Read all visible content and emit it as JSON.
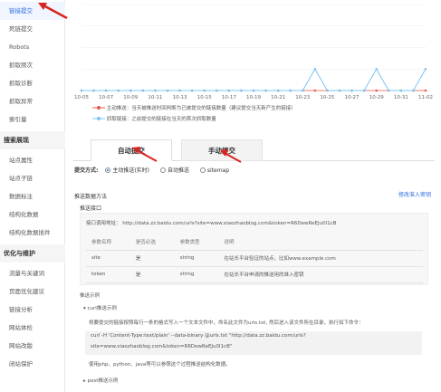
{
  "sidebar": {
    "items": [
      {
        "label": "链接提交",
        "active": true
      },
      {
        "label": "死链提交"
      },
      {
        "label": "Robots"
      },
      {
        "label": "抓取频次"
      },
      {
        "label": "抓取诊断"
      },
      {
        "label": "抓取异常"
      },
      {
        "label": "索引量"
      }
    ],
    "group1": "搜索展现",
    "group1_items": [
      {
        "label": "站点属性"
      },
      {
        "label": "站点子链"
      },
      {
        "label": "数据标注"
      },
      {
        "label": "结构化数据"
      },
      {
        "label": "结构化数据插件"
      }
    ],
    "group2": "优化与维护",
    "group2_items": [
      {
        "label": "流量与关键词"
      },
      {
        "label": "页面优化建议"
      },
      {
        "label": "链接分析"
      },
      {
        "label": "网站体检"
      },
      {
        "label": "网站改版"
      },
      {
        "label": "闭站保护"
      }
    ]
  },
  "chart_data": {
    "type": "line",
    "categories": [
      "10-05",
      "10-07",
      "10-09",
      "10-11",
      "10-13",
      "10-15",
      "10-17",
      "10-19",
      "10-21",
      "10-23",
      "10-25",
      "10-27",
      "10-29",
      "10-31",
      "11-02"
    ],
    "series": [
      {
        "name": "主动推送：当天被推送时间判断为已被提交的链接数量（建议提交当天新产生的链接）",
        "color": "#e8574e",
        "values": [
          0,
          0,
          0,
          0,
          0,
          0,
          0,
          0,
          0,
          0,
          0,
          0,
          0,
          0,
          0,
          0,
          0,
          0,
          0,
          0,
          0,
          0,
          0,
          0,
          0,
          0,
          0,
          0,
          0
        ]
      },
      {
        "name": "抓取链接：之前提交的链接在当天的首次抓取数量",
        "color": "#7ec4f2",
        "values": [
          0,
          0,
          0,
          0,
          0,
          0,
          0,
          0,
          0,
          0,
          0,
          0,
          0,
          0,
          0,
          0,
          0,
          0,
          0,
          1,
          0,
          0,
          0,
          0,
          1,
          0,
          0,
          0,
          1
        ]
      }
    ],
    "ylim": [
      0,
      4
    ],
    "grid": true
  },
  "tabs": [
    {
      "label": "自动提交",
      "active": true
    },
    {
      "label": "手动提交",
      "active": false
    }
  ],
  "submit_mode": {
    "label": "提交方式:",
    "options": [
      {
        "label": "主动推送(实时)",
        "selected": true
      },
      {
        "label": "自动推送",
        "selected": false
      },
      {
        "label": "sitemap",
        "selected": false
      }
    ]
  },
  "push_section": {
    "title": "推送数据方法",
    "modify_link": "修改准入密钥",
    "api_title": "推送接口",
    "api_url": "接口调用地址：  http://data.zz.baidu.com/urls?site=www.xiaozhaoblog.com&token=R6DewReEJu0l1cB",
    "table_headers": [
      "参数名称",
      "是否必选",
      "参数类型",
      "说明"
    ],
    "table_rows": [
      [
        "site",
        "是",
        "string",
        "在站长平台验证的站点，比如www.example.com"
      ],
      [
        "token",
        "是",
        "string",
        "在站长平台申请的推送用的准入密钥"
      ]
    ]
  },
  "example": {
    "title": "推送示例",
    "curl_label": "curl推送示例",
    "desc": "将要提交的链接按照每行一条的格式写入一个文本文件中，命名此文件为urls.txt, 然后进入该文件所在目录，执行如下命令：",
    "code1": "curl -H 'Content-Type:text/plain' --data-binary @urls.txt \"http://data.zz.baidu.com/urls?",
    "code2": "site=www.xiaozhaoblog.com&token=R6DewReEJu0l1cB\"",
    "note": "使用php、python、java等可以参照这个过程推送结构化数据。",
    "post_label": "post推送示例"
  }
}
